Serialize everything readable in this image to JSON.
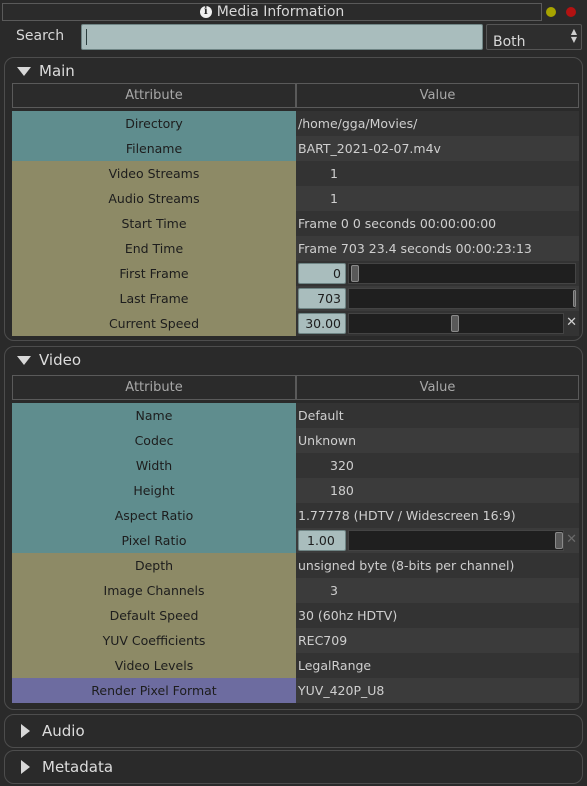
{
  "window": {
    "title": "Media Information"
  },
  "search": {
    "label": "Search",
    "value": "",
    "mode": "Both"
  },
  "main": {
    "title": "Main",
    "col_attr": "Attribute",
    "col_value": "Value",
    "rows": [
      {
        "attr": "Directory",
        "value": "/home/gga/Movies/"
      },
      {
        "attr": "Filename",
        "value": "BART_2021-02-07.m4v"
      },
      {
        "attr": "Video Streams",
        "value": "1"
      },
      {
        "attr": "Audio Streams",
        "value": "1"
      },
      {
        "attr": "Start Time",
        "value": "Frame 0 0 seconds 00:00:00:00"
      },
      {
        "attr": "End Time",
        "value": "Frame 703 23.4 seconds 00:00:23:13"
      },
      {
        "attr": "First Frame",
        "value": "0"
      },
      {
        "attr": "Last Frame",
        "value": "703"
      },
      {
        "attr": "Current Speed",
        "value": "30.00"
      }
    ]
  },
  "video": {
    "title": "Video",
    "col_attr": "Attribute",
    "col_value": "Value",
    "rows": [
      {
        "attr": "Name",
        "value": "Default"
      },
      {
        "attr": "Codec",
        "value": "Unknown"
      },
      {
        "attr": "Width",
        "value": "320"
      },
      {
        "attr": "Height",
        "value": "180"
      },
      {
        "attr": "Aspect Ratio",
        "value": "1.77778 (HDTV / Widescreen 16:9)"
      },
      {
        "attr": "Pixel Ratio",
        "value": "1.00"
      },
      {
        "attr": "Depth",
        "value": "unsigned byte (8-bits per channel)"
      },
      {
        "attr": "Image Channels",
        "value": "3"
      },
      {
        "attr": "Default Speed",
        "value": "30 (60hz HDTV)"
      },
      {
        "attr": "YUV Coefficients",
        "value": "REC709"
      },
      {
        "attr": "Video Levels",
        "value": "LegalRange"
      },
      {
        "attr": "Render Pixel Format",
        "value": "YUV_420P_U8"
      }
    ]
  },
  "audio": {
    "title": "Audio"
  },
  "metadata": {
    "title": "Metadata"
  }
}
